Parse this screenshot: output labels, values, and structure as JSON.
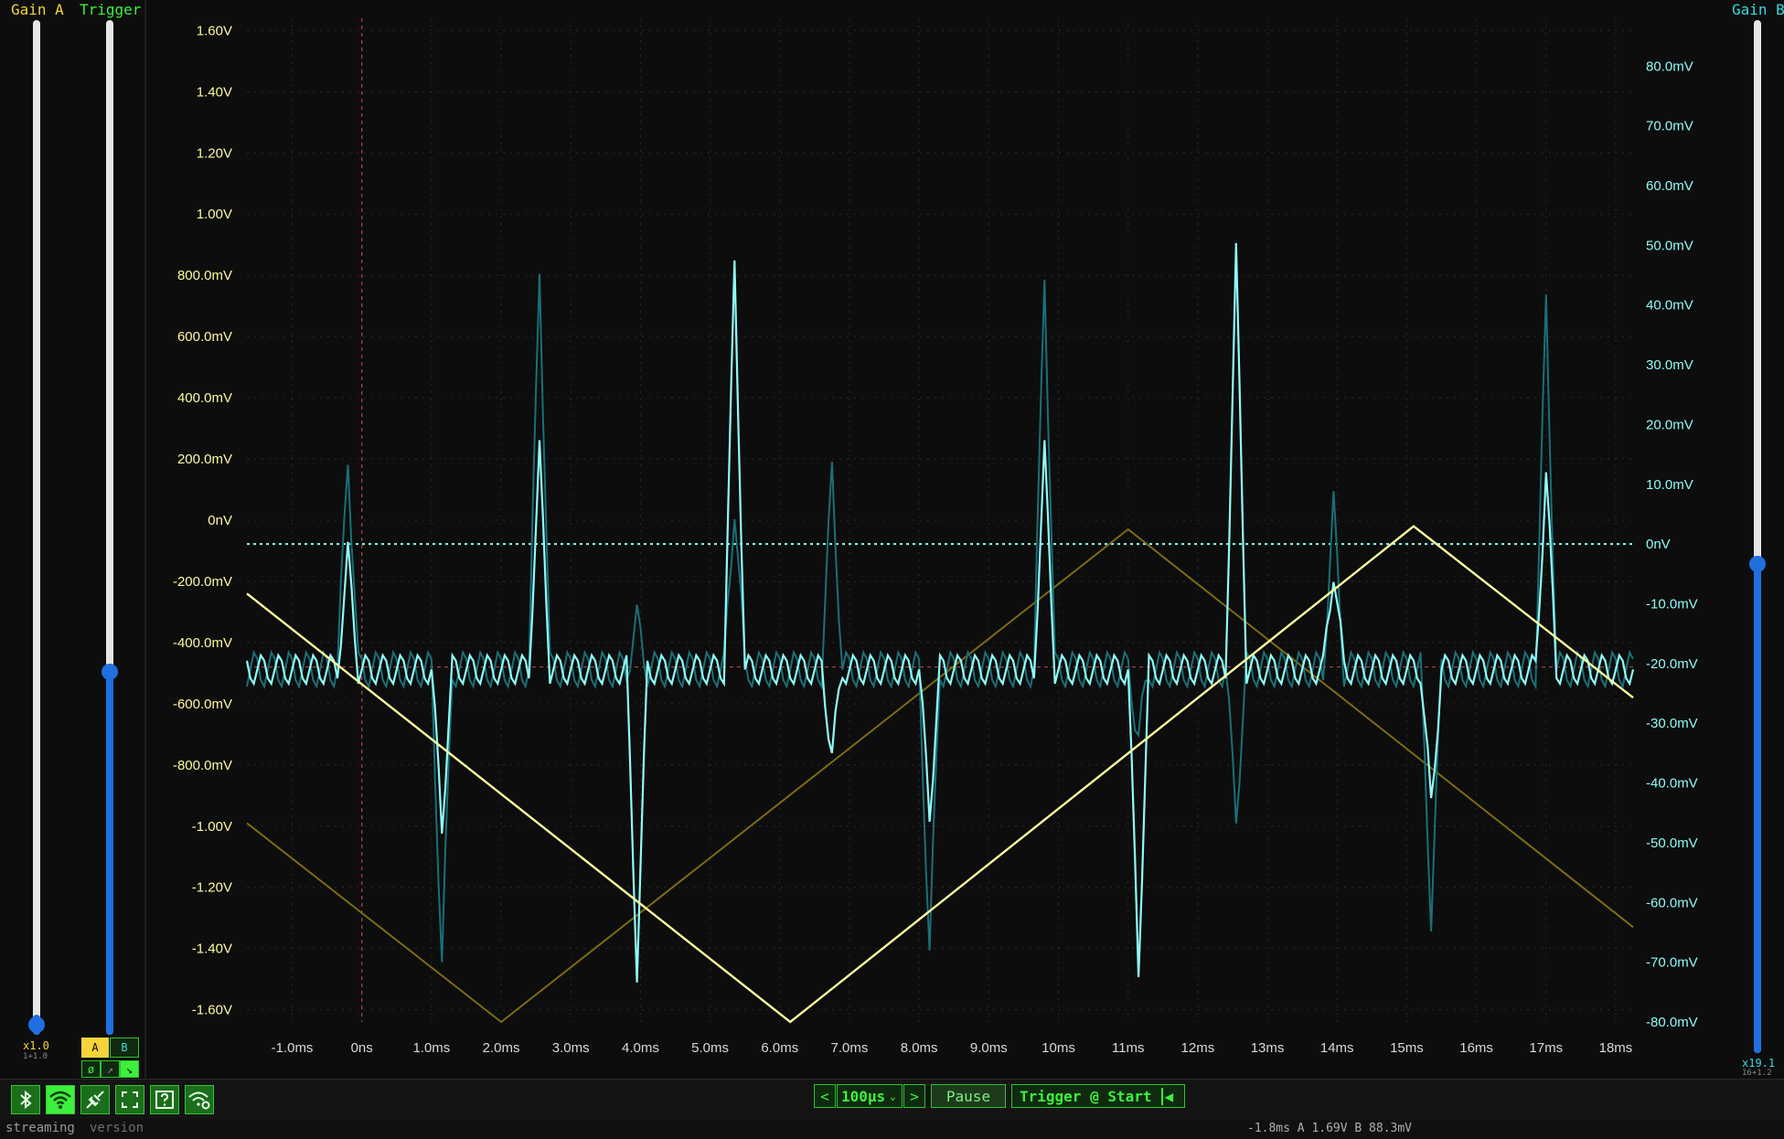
{
  "sliders": {
    "gain_a": {
      "label": "Gain A",
      "value_label": "x1.0",
      "sub_label": "1+1.0",
      "level": 0.0
    },
    "trigger": {
      "label": "Trigger",
      "level": 0.38
    },
    "gain_b": {
      "label": "Gain B",
      "value_label": "x19.1",
      "sub_label": "16+1.2",
      "level": 0.48
    }
  },
  "trigger_source": {
    "a_label": "A",
    "b_label": "B",
    "active": "A"
  },
  "trigger_edge": {
    "none_label": "ø",
    "rising_label": "↗",
    "falling_label": "↘",
    "active": "falling"
  },
  "toolbar": {
    "icons": [
      "bluetooth-icon",
      "wifi-icon",
      "serial-connect-icon",
      "fullscreen-icon",
      "help-icon",
      "wifi-settings-icon"
    ],
    "timebase_prev": "<",
    "timebase_value": "100µs",
    "timebase_next": ">",
    "pause_label": "Pause",
    "trigger_mode_label": "Trigger @ Start",
    "trigger_arrow": "◀"
  },
  "status": {
    "state": "streaming",
    "version": "version",
    "readout": "-1.8ms A 1.69V B 88.3mV"
  },
  "colors": {
    "channel_a": "#fdfaa0",
    "channel_a_dim": "#7c6b17",
    "channel_b": "#8ffbf8",
    "channel_b_dim": "#1b6f77",
    "trigger_label": "#3cf03c",
    "gain_a_label": "#f4d43a",
    "gain_b_label": "#38d9e0",
    "trigger_marker": "#b04848"
  },
  "chart_data": {
    "type": "line",
    "xlabel": "",
    "x_ticks": [
      "-1.0ms",
      "0ns",
      "1.0ms",
      "2.0ms",
      "3.0ms",
      "4.0ms",
      "5.0ms",
      "6.0ms",
      "7.0ms",
      "8.0ms",
      "9.0ms",
      "10ms",
      "11ms",
      "12ms",
      "13ms",
      "14ms",
      "15ms",
      "16ms",
      "17ms",
      "18ms"
    ],
    "x_tick_values": [
      -1,
      0,
      1,
      2,
      3,
      4,
      5,
      6,
      7,
      8,
      9,
      10,
      11,
      12,
      13,
      14,
      15,
      16,
      17,
      18
    ],
    "xlim": [
      -1.65,
      18.25
    ],
    "left_axis": {
      "ticks": [
        "1.60V",
        "1.40V",
        "1.20V",
        "1.00V",
        "800.0mV",
        "600.0mV",
        "400.0mV",
        "200.0mV",
        "0nV",
        "-200.0mV",
        "-400.0mV",
        "-600.0mV",
        "-800.0mV",
        "-1.00V",
        "-1.20V",
        "-1.40V",
        "-1.60V"
      ],
      "tick_values": [
        1.6,
        1.4,
        1.2,
        1.0,
        0.8,
        0.6,
        0.4,
        0.2,
        0,
        -0.2,
        -0.4,
        -0.6,
        -0.8,
        -1.0,
        -1.2,
        -1.4,
        -1.6
      ],
      "ylim": [
        -1.64,
        1.64
      ]
    },
    "right_axis": {
      "ticks": [
        "80.0mV",
        "70.0mV",
        "60.0mV",
        "50.0mV",
        "40.0mV",
        "30.0mV",
        "20.0mV",
        "10.0mV",
        "0nV",
        "-10.0mV",
        "-20.0mV",
        "-30.0mV",
        "-40.0mV",
        "-50.0mV",
        "-60.0mV",
        "-70.0mV",
        "-80.0mV"
      ],
      "tick_values": [
        80,
        70,
        60,
        50,
        40,
        30,
        20,
        10,
        0,
        -10,
        -20,
        -30,
        -40,
        -50,
        -60,
        -70,
        -80
      ],
      "ylim": [
        -80.0,
        88.0
      ]
    },
    "grid": true,
    "trigger_time_ms": 0,
    "trigger_level_v": -0.48,
    "zero_line_mv": 0,
    "series": [
      {
        "channel": "A",
        "axis": "left",
        "x": [
          -1.65,
          6.15,
          15.1,
          18.25
        ],
        "y": [
          -0.24,
          -1.64,
          -0.02,
          -0.58
        ]
      },
      {
        "channel": "A-previous",
        "axis": "left",
        "x": [
          -1.65,
          2.0,
          11.0,
          18.25
        ],
        "y": [
          -0.99,
          -1.64,
          -0.03,
          -1.33
        ]
      },
      {
        "channel": "B",
        "axis": "right",
        "spikes_ms": [
          -0.2,
          1.15,
          2.55,
          3.95,
          5.35,
          6.75,
          8.15,
          9.8,
          11.15,
          12.55,
          13.95,
          15.35,
          17.0
        ],
        "spike_peak_mv": [
          -2,
          -47,
          15,
          -71,
          46,
          -35,
          -45,
          15,
          -71,
          48,
          -4,
          -44,
          12
        ],
        "baseline_mv": -21,
        "ripple_mv": 2.5
      },
      {
        "channel": "B-previous",
        "axis": "right",
        "spikes_ms": [
          -0.2,
          1.15,
          2.55,
          3.95,
          5.35,
          6.75,
          8.15,
          9.8,
          11.15,
          12.55,
          13.95,
          15.35,
          17.0
        ],
        "spike_peak_mv": [
          15,
          -70,
          47,
          -13,
          7,
          12,
          -68,
          46,
          -32,
          -45,
          6,
          -62,
          40
        ],
        "baseline_mv": -21,
        "ripple_mv": 3
      }
    ]
  }
}
